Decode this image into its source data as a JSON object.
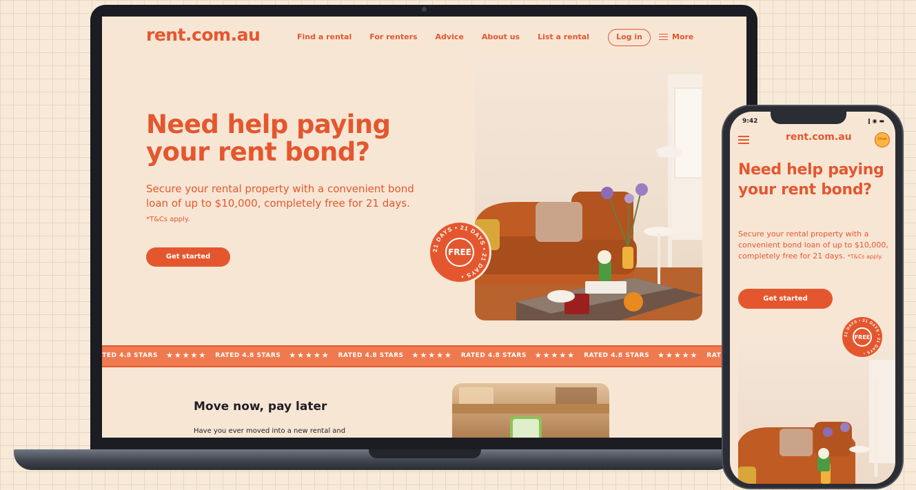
{
  "site": {
    "logo": "rent.com.au",
    "nav": [
      "Find a rental",
      "For renters",
      "Advice",
      "About us",
      "List a rental"
    ],
    "login_label": "Log in",
    "more_label": "More"
  },
  "hero": {
    "title": "Need help paying your rent bond?",
    "subtitle": "Secure your rental property with a convenient bond loan of up to $10,000, completely free for 21 days.",
    "tcs": "*T&Cs apply.",
    "cta_label": "Get started"
  },
  "badge": {
    "center": "FREE",
    "ring": "21 DAYS • 21 DAYS • 21 DAYS •"
  },
  "strip": {
    "label": "RATED 4.8 STARS",
    "stars": "★★★★★"
  },
  "section2": {
    "title": "Move now, pay later",
    "body": "Have you ever moved into a new rental and"
  },
  "phone": {
    "time": "9:42",
    "status_icons": "‖ ◉ ▬",
    "logo": "rent.com.au",
    "chat_label": "Chat",
    "title": "Need help paying your rent bond?",
    "subtitle": "Secure your rental property with a convenient bond loan of up to $10,000, completely free for 21 days.",
    "tcs": "*T&Cs apply.",
    "cta_label": "Get started"
  },
  "colors": {
    "brand": "#e4572e",
    "background": "#f8e6d5",
    "strip": "#f07a4f"
  }
}
